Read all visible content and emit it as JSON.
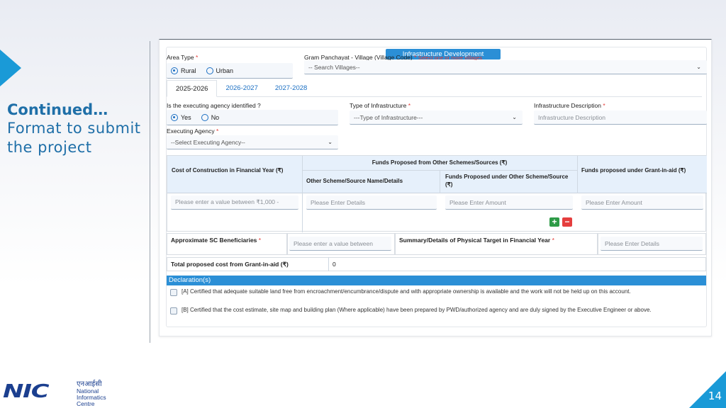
{
  "slide": {
    "heading_line1": "Continued…",
    "heading_line2": "Format to submit",
    "heading_line3": "the project",
    "page_number": "14",
    "logo": {
      "mark": "NIC",
      "hindi": "एनआईसी",
      "line1": "National",
      "line2": "Informatics",
      "line3": "Centre"
    }
  },
  "form": {
    "section_title": "Infrastructure Development",
    "area_type": {
      "label": "Area Type",
      "options": [
        "Rural",
        "Urban"
      ],
      "selected": "Rural"
    },
    "village": {
      "label": "Gram Panchayat - Village (Village Code)",
      "note": "Select one or more villages",
      "placeholder": "-- Search Villages--"
    },
    "tabs": [
      "2025-2026",
      "2026-2027",
      "2027-2028"
    ],
    "agency_identified": {
      "label": "Is the executing agency identified ?",
      "options": [
        "Yes",
        "No"
      ],
      "selected": "Yes"
    },
    "infra_type": {
      "label": "Type of Infrastructure",
      "placeholder": "---Type of Infrastructure---"
    },
    "infra_desc": {
      "label": "Infrastructure Description",
      "placeholder": "Infrastructure Description"
    },
    "exec_agency": {
      "label": "Executing Agency",
      "placeholder": "--Select Executing Agency--"
    },
    "funds_table": {
      "cost_header": "Cost of Construction in Financial Year (₹)",
      "other_funds_header": "Funds Proposed from Other Schemes/Sources (₹)",
      "other_scheme_header": "Other Scheme/Source Name/Details",
      "funds_other_header": "Funds Proposed under Other Scheme/Source (₹)",
      "grant_header": "Funds proposed under Grant-in-aid (₹)",
      "cost_placeholder": "Please enter a value between ₹1,000 -",
      "details_placeholder": "Please Enter Details",
      "amount_placeholder": "Please Enter Amount",
      "grant_placeholder": "Please Enter Amount",
      "add_label": "+",
      "remove_label": "−"
    },
    "sc_beneficiaries": {
      "label": "Approximate SC Beneficiaries",
      "placeholder": "Please enter a value between"
    },
    "summary": {
      "label": "Summary/Details of Physical Target in Financial Year",
      "placeholder": "Please Enter Details"
    },
    "total_cost": {
      "label": "Total proposed cost from Grant-in-aid (₹)",
      "value": "0"
    },
    "declaration": {
      "title": "Declaration(s)",
      "items": [
        "[A] Certified that adequate suitable land free from encroachment/encumbrance/dispute and with appropriate ownership is available and the work will not be held up on this account.",
        "[B] Certified that the cost estimate, site map and building plan (Where applicable) have been prepared by PWD/authorized agency and are duly signed by the Executive Engineer or above."
      ]
    },
    "required_mark": "*"
  },
  "colors": {
    "accent": "#2b8fd6",
    "brand": "#1a9ad7",
    "heading": "#1f6fa8",
    "required": "#e53935",
    "add": "#2e9b47",
    "remove": "#e53e3e"
  }
}
